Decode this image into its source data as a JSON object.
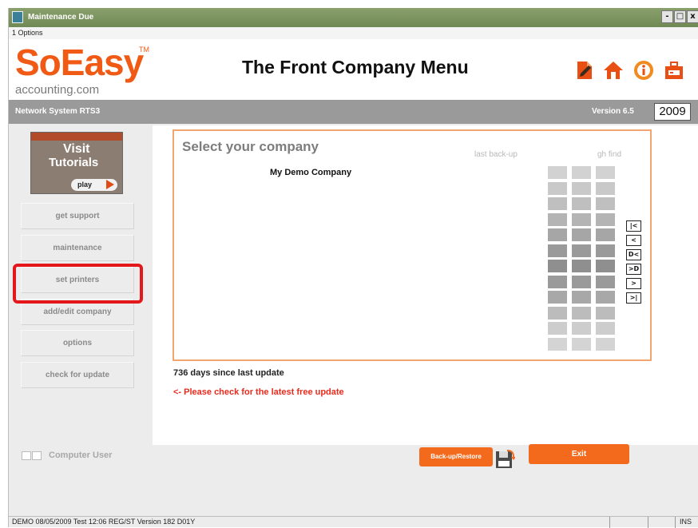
{
  "window": {
    "title": "Maintenance Due",
    "buttons": [
      "-",
      "□",
      "x"
    ]
  },
  "menubar": {
    "item": "1 Options"
  },
  "header": {
    "logo_main": "SoEasy",
    "logo_tm": "TM",
    "logo_sub": "accounting.com",
    "menu_title": "The Front Company Menu",
    "icons": [
      "document-icon",
      "home-icon",
      "info-icon",
      "briefcase-icon"
    ]
  },
  "infobar": {
    "network": "Network System RTS3",
    "version": "Version 6.5",
    "year": "2009"
  },
  "tutorial": {
    "line1": "Visit",
    "line2": "Tutorials",
    "play": "play"
  },
  "sidebar": {
    "buttons": [
      "get support",
      "maintenance",
      "set printers",
      "add/edit company",
      "options",
      "check for update"
    ]
  },
  "panel": {
    "title": "Select your company",
    "col_backup": "last back-up",
    "col_find": "gh find",
    "companies": [
      "My Demo Company"
    ]
  },
  "nav": [
    "first-record-icon",
    "previous-record-icon",
    "insert-record-icon",
    "new-record-icon",
    "next-record-icon",
    "last-record-icon"
  ],
  "update": {
    "days_text": "736 days since last update",
    "message": "<- Please check for the latest free update"
  },
  "footer": {
    "computer_user": "Computer User",
    "backup_restore": "Back-up/Restore",
    "exit": "Exit"
  },
  "statusbar": {
    "text": "DEMO 08/05/2009 Test 12:06 REG/ST Version     182 D01Y",
    "mode": "INS"
  },
  "colors": {
    "brand": "#f05a14",
    "highlight": "#e4181b",
    "arrow": "#ffef00",
    "panel_border": "#f1a672"
  }
}
